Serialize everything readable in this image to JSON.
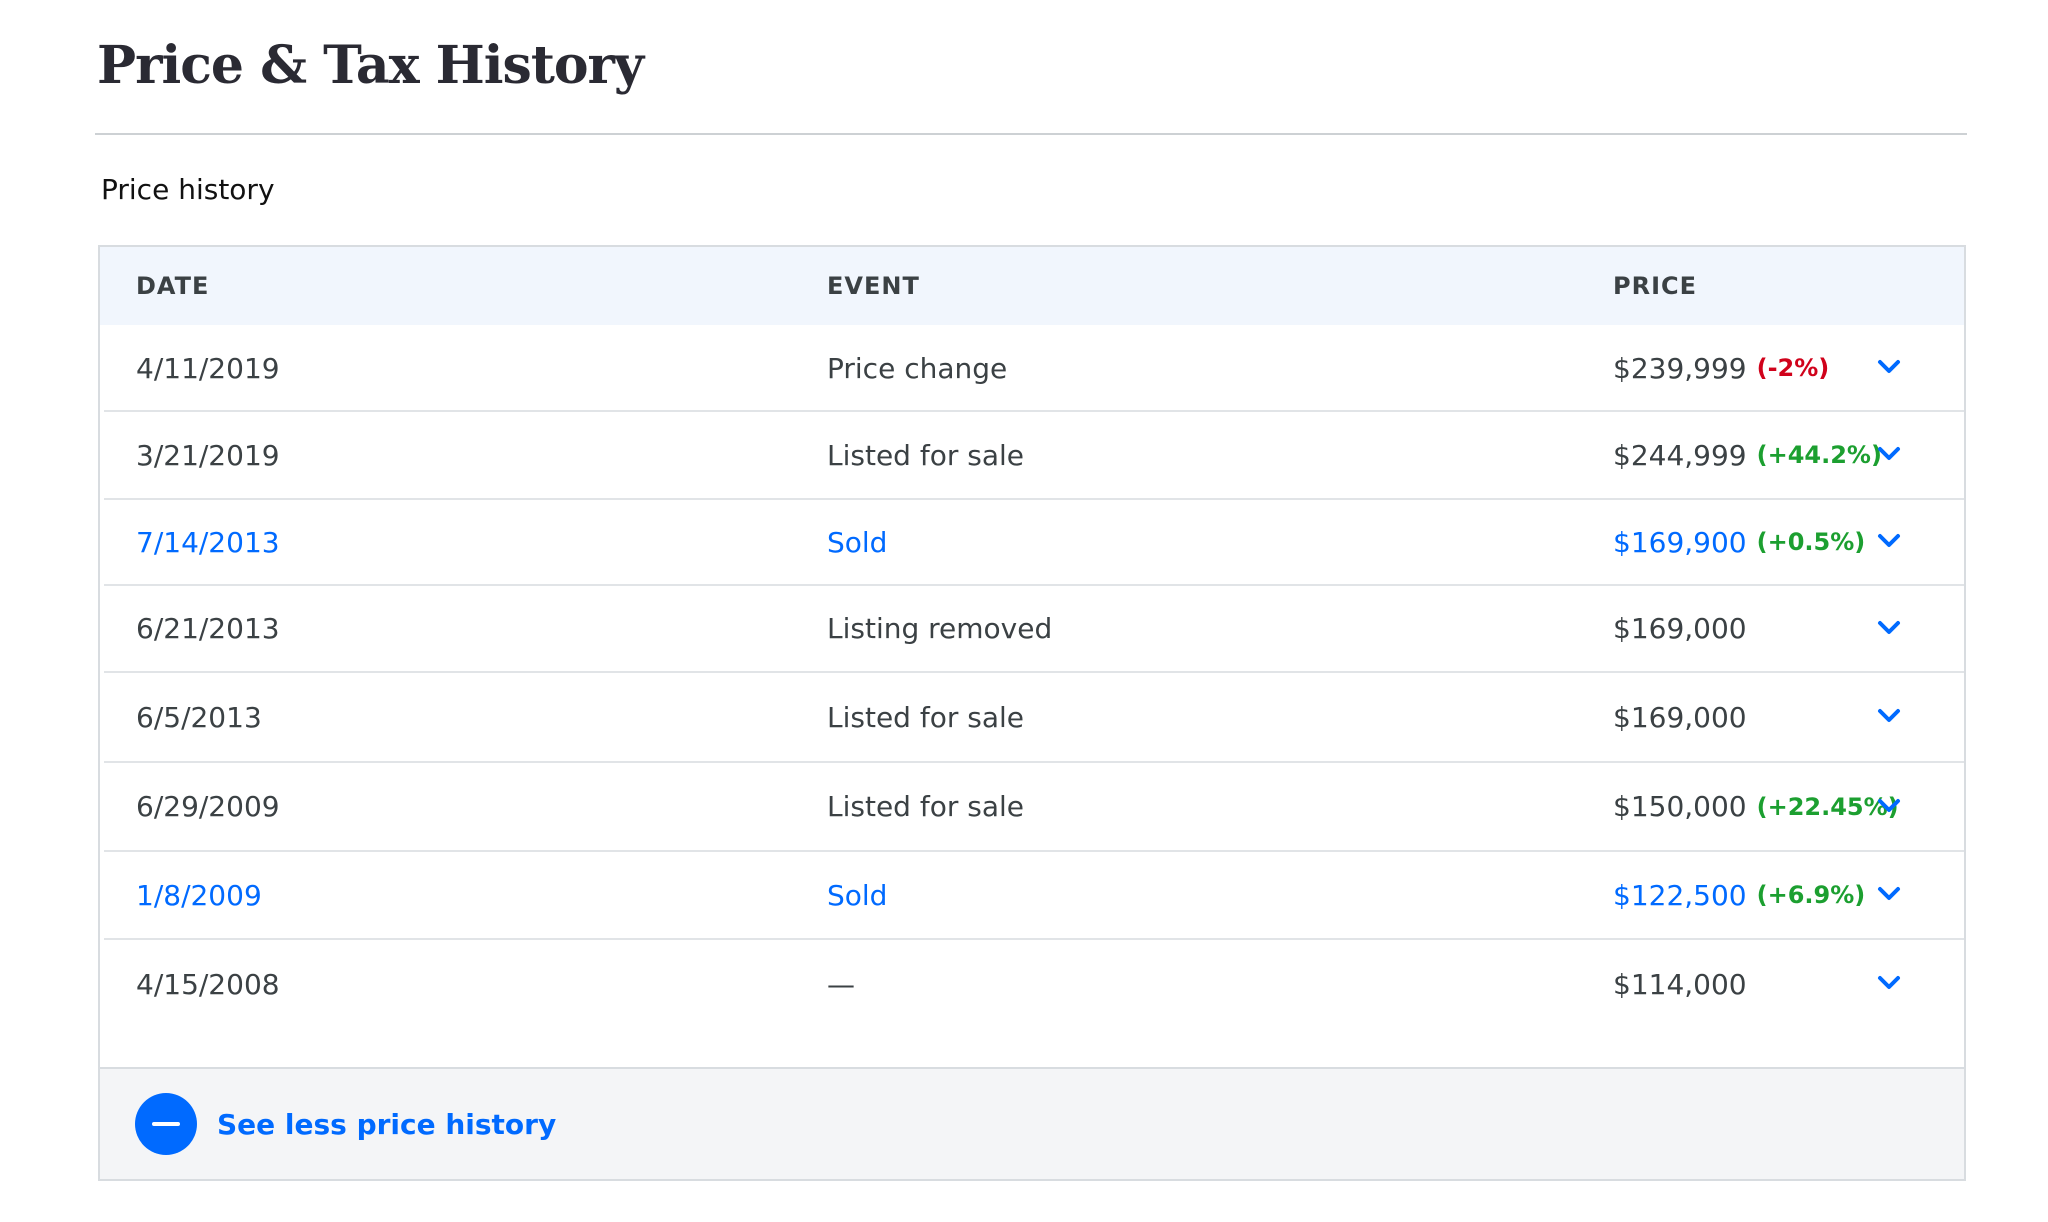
{
  "page": {
    "title": "Price & Tax History",
    "section_title": "Price history"
  },
  "table": {
    "headers": {
      "date": "DATE",
      "event": "EVENT",
      "price": "PRICE"
    },
    "rows": [
      {
        "date": "4/11/2019",
        "event": "Price change",
        "price": "$239,999",
        "change": "(-2%)",
        "change_sign": "neg",
        "sold": false
      },
      {
        "date": "3/21/2019",
        "event": "Listed for sale",
        "price": "$244,999",
        "change": "(+44.2%)",
        "change_sign": "pos",
        "sold": false
      },
      {
        "date": "7/14/2013",
        "event": "Sold",
        "price": "$169,900",
        "change": "(+0.5%)",
        "change_sign": "pos",
        "sold": true
      },
      {
        "date": "6/21/2013",
        "event": "Listing removed",
        "price": "$169,000",
        "change": "",
        "change_sign": "",
        "sold": false
      },
      {
        "date": "6/5/2013",
        "event": "Listed for sale",
        "price": "$169,000",
        "change": "",
        "change_sign": "",
        "sold": false
      },
      {
        "date": "6/29/2009",
        "event": "Listed for sale",
        "price": "$150,000",
        "change": "(+22.45%)",
        "change_sign": "pos",
        "sold": false
      },
      {
        "date": "1/8/2009",
        "event": "Sold",
        "price": "$122,500",
        "change": "(+6.9%)",
        "change_sign": "pos",
        "sold": true
      },
      {
        "date": "4/15/2008",
        "event": "—",
        "price": "$114,000",
        "change": "",
        "change_sign": "",
        "sold": false
      }
    ]
  },
  "footer": {
    "see_less_label": "See less price history"
  },
  "colors": {
    "accent": "#006aff",
    "negative": "#d0021b",
    "positive": "#1c9f30",
    "header_bg": "#f1f6fd",
    "footer_bg": "#f4f5f7"
  },
  "icons": {
    "row_expand": "chevron-down-icon",
    "collapse": "minus-circle-icon"
  }
}
